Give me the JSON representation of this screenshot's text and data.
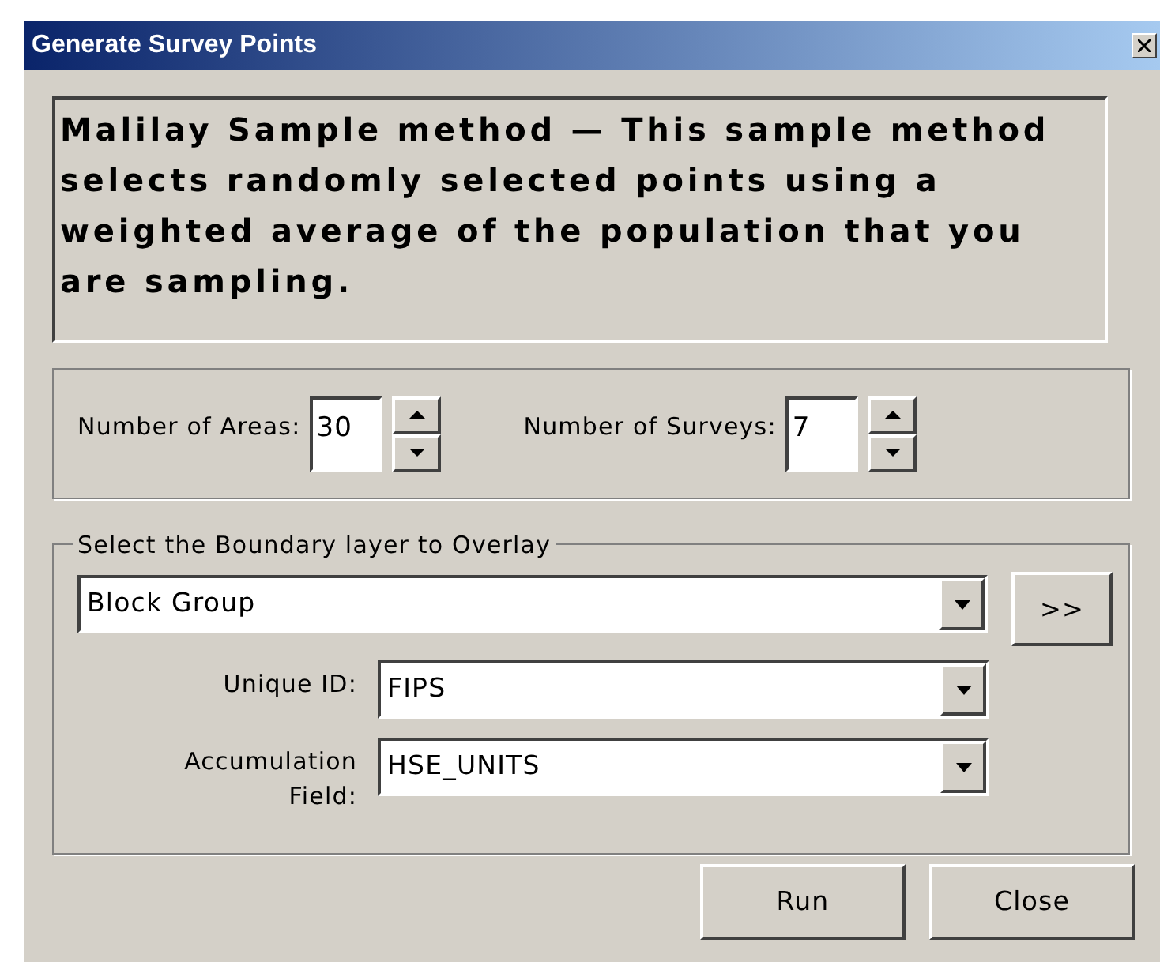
{
  "window": {
    "title": "Generate Survey Points"
  },
  "description": "Malilay Sample method — This sample method selects randomly selected points using a weighted average of the population that you are sampling.",
  "spinners": [
    {
      "label": "Number of Areas:",
      "value": "30"
    },
    {
      "label": "Number of Surveys:",
      "value": "7"
    }
  ],
  "boundary_group": {
    "title": "Select the Boundary layer to Overlay",
    "layer": "Block Group",
    "browse_button": ">>",
    "fields": [
      {
        "label": "Unique ID:",
        "value": "FIPS"
      },
      {
        "label": "Accumulation Field:",
        "value": "HSE_UNITS"
      }
    ]
  },
  "buttons": [
    "Run",
    "Close"
  ]
}
